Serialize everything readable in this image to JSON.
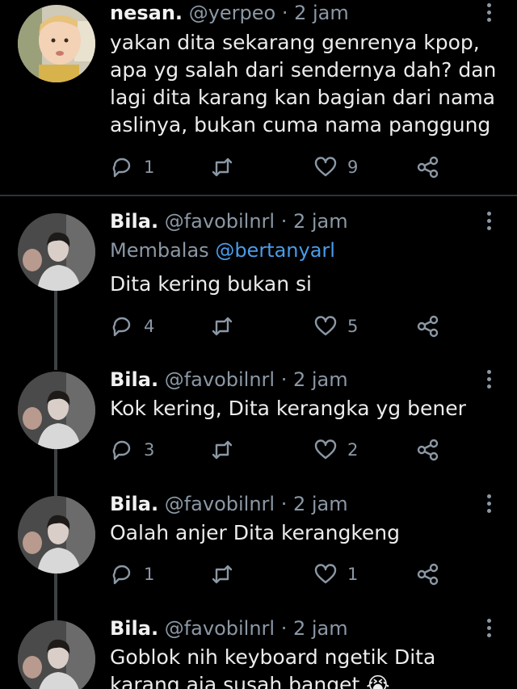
{
  "tweets": [
    {
      "name": "nesan.",
      "handle": "@yerpeo",
      "time": "· 2 jam",
      "reply_prefix": "",
      "reply_mention": "",
      "text": "yakan dita sekarang genrenya kpop, apa yg salah dari sendernya dah? dan lagi dita karang kan bagian dari nama aslinya, bukan cuma nama panggung",
      "replies": "1",
      "retweets": "",
      "likes": "9"
    },
    {
      "name": "Bila.",
      "handle": "@favobilnrl",
      "time": "· 2 jam",
      "reply_prefix": "Membalas",
      "reply_mention": "@bertanyarl",
      "text": "Dita kering bukan si",
      "replies": "4",
      "retweets": "",
      "likes": "5"
    },
    {
      "name": "Bila.",
      "handle": "@favobilnrl",
      "time": "· 2 jam",
      "reply_prefix": "",
      "reply_mention": "",
      "text": "Kok kering, Dita kerangka yg bener",
      "replies": "3",
      "retweets": "",
      "likes": "2"
    },
    {
      "name": "Bila.",
      "handle": "@favobilnrl",
      "time": "· 2 jam",
      "reply_prefix": "",
      "reply_mention": "",
      "text": "Oalah anjer Dita kerangkeng",
      "replies": "1",
      "retweets": "",
      "likes": "1"
    },
    {
      "name": "Bila.",
      "handle": "@favobilnrl",
      "time": "· 2 jam",
      "reply_prefix": "",
      "reply_mention": "",
      "text": "Goblok nih keyboard ngetik Dita karang aja susah banget 😭",
      "replies": "",
      "retweets": "",
      "likes": ""
    }
  ],
  "icons": {
    "reply": "reply-icon",
    "retweet": "retweet-icon",
    "like": "heart-icon",
    "share": "share-icon",
    "more": "more-vertical-icon"
  },
  "colors": {
    "background": "#000000",
    "mention": "#4a9ce8",
    "muted": "#8b98a5",
    "divider": "#2f3336"
  }
}
